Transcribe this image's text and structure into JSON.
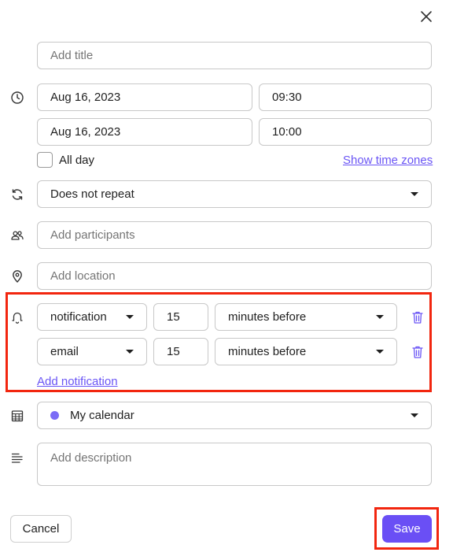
{
  "title_field": {
    "placeholder": "Add title"
  },
  "start": {
    "date": "Aug 16, 2023",
    "time": "09:30"
  },
  "end": {
    "date": "Aug 16, 2023",
    "time": "10:00"
  },
  "all_day": {
    "label": "All day",
    "checked": false
  },
  "time_zones_link": "Show time zones",
  "repeat": {
    "value": "Does not repeat"
  },
  "participants": {
    "placeholder": "Add participants"
  },
  "location": {
    "placeholder": "Add location"
  },
  "notifications": [
    {
      "type": "notification",
      "amount": "15",
      "unit": "minutes before"
    },
    {
      "type": "email",
      "amount": "15",
      "unit": "minutes before"
    }
  ],
  "add_notification_link": "Add notification",
  "calendar": {
    "value": "My calendar",
    "color": "#7b6cf6"
  },
  "description": {
    "placeholder": "Add description"
  },
  "buttons": {
    "cancel": "Cancel",
    "save": "Save"
  },
  "colors": {
    "accent": "#6a4ff5",
    "link": "#6a55f5",
    "highlight": "#f2260f"
  },
  "icons": {
    "close": "close-icon",
    "clock": "clock-icon",
    "repeat": "repeat-icon",
    "participants": "participants-icon",
    "location": "location-pin-icon",
    "bell": "bell-icon",
    "calendar": "calendar-icon",
    "description": "description-icon",
    "trash": "trash-icon"
  }
}
